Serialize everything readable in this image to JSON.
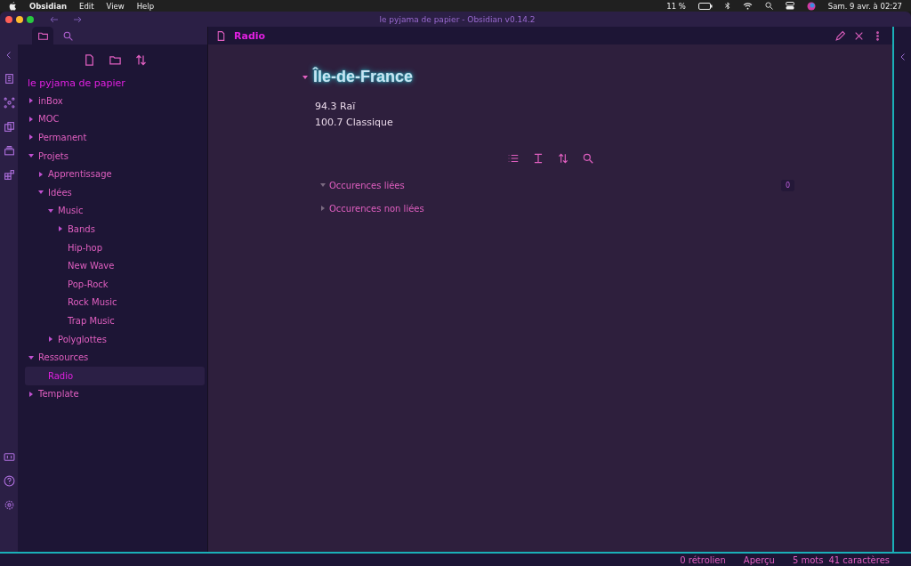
{
  "menubar": {
    "app": "Obsidian",
    "menus": [
      "Edit",
      "View",
      "Help"
    ],
    "battery": "11 %",
    "clock": "Sam. 9 avr. à  02:27"
  },
  "window": {
    "title": "le pyjama de papier - Obsidian v0.14.2"
  },
  "sidebar": {
    "tabs": [
      {
        "kind": "files",
        "selected": true
      },
      {
        "kind": "search",
        "selected": false
      }
    ],
    "vault": "le pyjama de papier",
    "tree": [
      {
        "label": "inBox",
        "kind": "folder",
        "expanded": false,
        "selected": false
      },
      {
        "label": "MOC",
        "kind": "folder",
        "expanded": false,
        "selected": false
      },
      {
        "label": "Permanent",
        "kind": "folder",
        "expanded": false,
        "selected": false
      },
      {
        "label": "Projets",
        "kind": "folder",
        "expanded": true,
        "selected": false,
        "children": [
          {
            "label": "Apprentissage",
            "kind": "folder",
            "expanded": false,
            "selected": false
          },
          {
            "label": "Idées",
            "kind": "folder",
            "expanded": true,
            "selected": false,
            "children": [
              {
                "label": "Music",
                "kind": "folder",
                "expanded": true,
                "selected": false,
                "children": [
                  {
                    "label": "Bands",
                    "kind": "folder",
                    "expanded": false,
                    "selected": false
                  },
                  {
                    "label": "Hip-hop",
                    "kind": "file",
                    "selected": false
                  },
                  {
                    "label": "New Wave",
                    "kind": "file",
                    "selected": false
                  },
                  {
                    "label": "Pop-Rock",
                    "kind": "file",
                    "selected": false
                  },
                  {
                    "label": "Rock Music",
                    "kind": "file",
                    "selected": false
                  },
                  {
                    "label": "Trap Music",
                    "kind": "file",
                    "selected": false
                  }
                ]
              },
              {
                "label": "Polyglottes",
                "kind": "folder",
                "expanded": false,
                "selected": false
              }
            ]
          }
        ]
      },
      {
        "label": "Ressources",
        "kind": "folder",
        "expanded": true,
        "selected": false,
        "children": [
          {
            "label": "Radio",
            "kind": "file",
            "selected": true
          }
        ]
      },
      {
        "label": "Template",
        "kind": "folder",
        "expanded": false,
        "selected": false
      }
    ]
  },
  "note": {
    "tab_title": "Radio",
    "heading": "Île-de-France",
    "heading_expanded": true,
    "lines": [
      "94.3 Raï",
      "100.7 Classique"
    ],
    "backlinks": [
      {
        "label": "Occurences liées",
        "expanded": true,
        "count": "0"
      },
      {
        "label": "Occurences non liées",
        "expanded": false
      }
    ]
  },
  "status_bar": [
    "0 rétrolien",
    "Aperçu",
    "5 mots",
    "41 caractères"
  ]
}
